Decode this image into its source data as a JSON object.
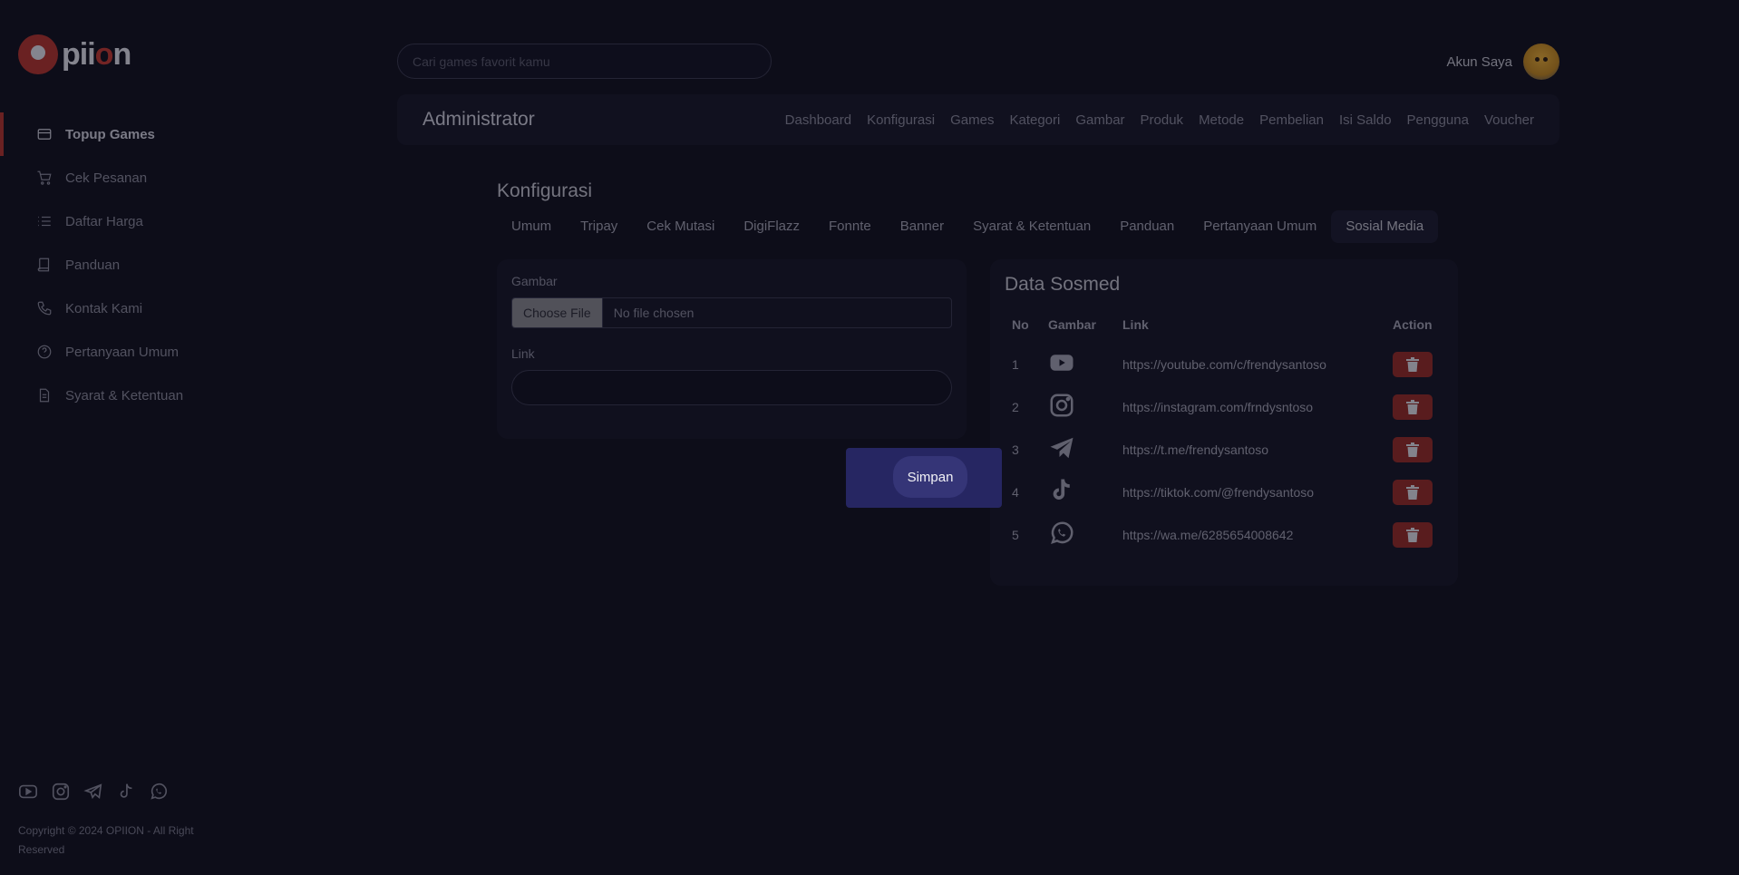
{
  "brand": {
    "logo_text_a": "pii",
    "logo_text_o": "o",
    "logo_text_b": "n",
    "accent": "#b8342b"
  },
  "sidebar": {
    "items": [
      {
        "label": "Topup Games",
        "icon": "card-icon",
        "active": true
      },
      {
        "label": "Cek Pesanan",
        "icon": "cart-icon"
      },
      {
        "label": "Daftar Harga",
        "icon": "list-icon"
      },
      {
        "label": "Panduan",
        "icon": "book-icon"
      },
      {
        "label": "Kontak Kami",
        "icon": "phone-icon"
      },
      {
        "label": "Pertanyaan Umum",
        "icon": "help-circle-icon"
      },
      {
        "label": "Syarat & Ketentuan",
        "icon": "document-icon"
      }
    ],
    "social_icons": [
      "youtube-icon",
      "instagram-icon",
      "telegram-icon",
      "tiktok-icon",
      "whatsapp-icon"
    ],
    "copyright": "Copyright © 2024 OPIION - All Right Reserved"
  },
  "header": {
    "search_placeholder": "Cari games favorit kamu",
    "account_label": "Akun Saya"
  },
  "admin": {
    "title": "Administrator",
    "menu": [
      "Dashboard",
      "Konfigurasi",
      "Games",
      "Kategori",
      "Gambar",
      "Produk",
      "Metode",
      "Pembelian",
      "Isi Saldo",
      "Pengguna",
      "Voucher"
    ]
  },
  "config": {
    "title": "Konfigurasi",
    "tabs": [
      "Umum",
      "Tripay",
      "Cek Mutasi",
      "DigiFlazz",
      "Fonnte",
      "Banner",
      "Syarat & Ketentuan",
      "Panduan",
      "Pertanyaan Umum",
      "Sosial Media"
    ],
    "active_tab": "Sosial Media",
    "form": {
      "image_label": "Gambar",
      "file_button": "Choose File",
      "file_status": "No file chosen",
      "link_label": "Link",
      "link_value": ""
    },
    "save_label": "Simpan"
  },
  "sosmed": {
    "title": "Data Sosmed",
    "columns": [
      "No",
      "Gambar",
      "Link",
      "Action"
    ],
    "rows": [
      {
        "no": "1",
        "icon": "youtube-icon",
        "link": "https://youtube.com/c/frendysantoso"
      },
      {
        "no": "2",
        "icon": "instagram-icon",
        "link": "https://instagram.com/frndysntoso"
      },
      {
        "no": "3",
        "icon": "telegram-icon",
        "link": "https://t.me/frendysantoso"
      },
      {
        "no": "4",
        "icon": "tiktok-icon",
        "link": "https://tiktok.com/@frendysantoso"
      },
      {
        "no": "5",
        "icon": "whatsapp-icon",
        "link": "https://wa.me/6285654008642"
      }
    ]
  }
}
